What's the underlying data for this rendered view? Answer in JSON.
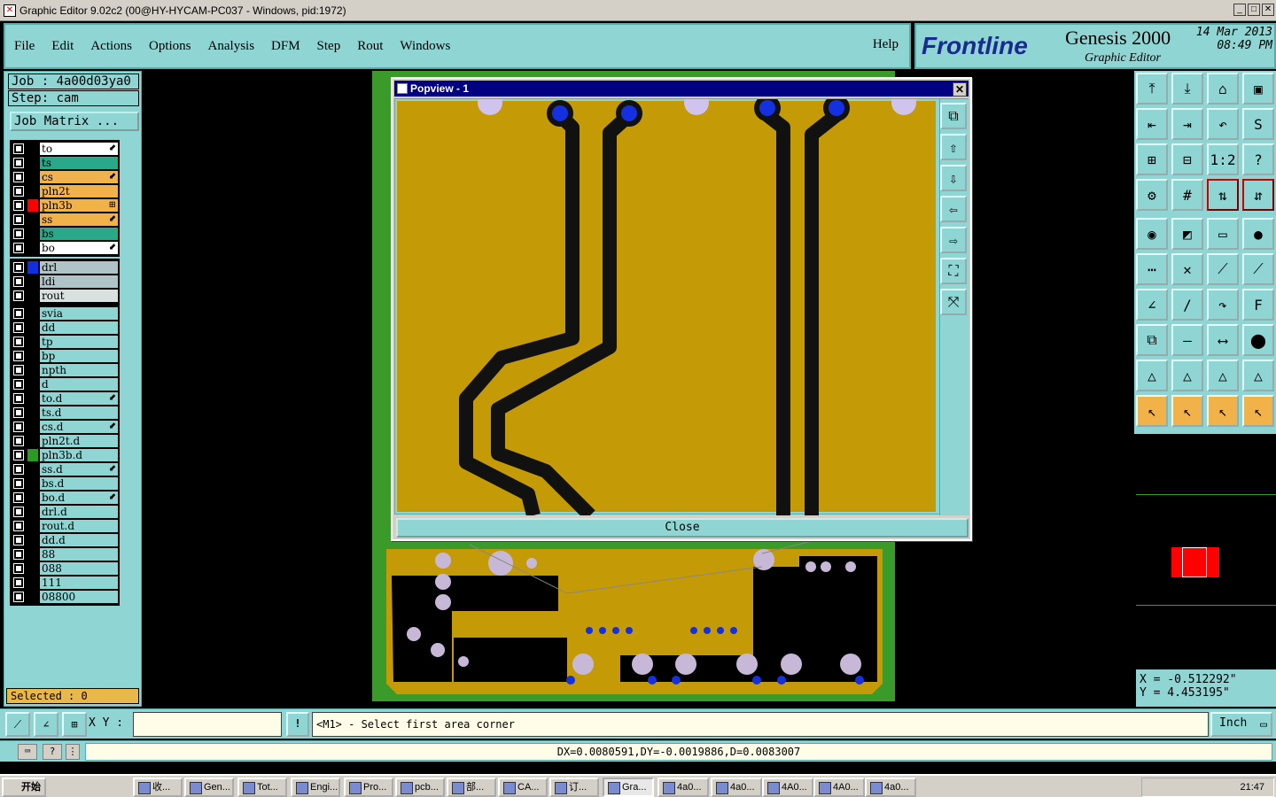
{
  "window": {
    "title": "Graphic Editor 9.02c2 (00@HY-HYCAM-PC037 - Windows, pid:1972)"
  },
  "menu": {
    "items": [
      "File",
      "Edit",
      "Actions",
      "Options",
      "Analysis",
      "DFM",
      "Step",
      "Rout",
      "Windows"
    ],
    "help": "Help"
  },
  "brand": {
    "logo": "Frontline",
    "product": "Genesis 2000",
    "subtitle": "Graphic Editor",
    "date": "14 Mar 2013",
    "time": "08:49 PM"
  },
  "job": {
    "job": "Job : 4a00d03ya0",
    "step": "Step: cam",
    "matrix_button": "Job Matrix ..."
  },
  "layers_group1": [
    {
      "name": "to",
      "color": "#ffffff",
      "mark": "⬋",
      "sw": "#000000"
    },
    {
      "name": "ts",
      "color": "#2aa88a",
      "mark": "",
      "sw": "#000000"
    },
    {
      "name": "cs",
      "color": "#f2b24a",
      "mark": "⬋",
      "sw": "#000000"
    },
    {
      "name": "pln2t",
      "color": "#f2b24a",
      "mark": "",
      "sw": "#000000"
    },
    {
      "name": "pln3b",
      "color": "#f2b24a",
      "mark": "⊞",
      "sw": "#ff0000"
    },
    {
      "name": "ss",
      "color": "#f2b24a",
      "mark": "⬋",
      "sw": "#000000"
    },
    {
      "name": "bs",
      "color": "#2aa88a",
      "mark": "",
      "sw": "#000000"
    },
    {
      "name": "bo",
      "color": "#ffffff",
      "mark": "⬋",
      "sw": "#000000"
    }
  ],
  "layers_group2": [
    {
      "name": "drl",
      "color": "#b0c4c8",
      "mark": "",
      "sw": "#1030e0"
    },
    {
      "name": "ldi",
      "color": "#b0c4c8",
      "mark": "",
      "sw": "#000000"
    },
    {
      "name": "rout",
      "color": "#d8e0e0",
      "mark": "",
      "sw": "#000000"
    }
  ],
  "layers_group3": [
    {
      "name": "svia",
      "mark": "",
      "sw": "#000000"
    },
    {
      "name": "dd",
      "mark": "",
      "sw": "#000000"
    },
    {
      "name": "tp",
      "mark": "",
      "sw": "#000000"
    },
    {
      "name": "bp",
      "mark": "",
      "sw": "#000000"
    },
    {
      "name": "npth",
      "mark": "",
      "sw": "#000000"
    },
    {
      "name": "d",
      "mark": "",
      "sw": "#000000"
    },
    {
      "name": "to.d",
      "mark": "⬋",
      "sw": "#000000"
    },
    {
      "name": "ts.d",
      "mark": "",
      "sw": "#000000"
    },
    {
      "name": "cs.d",
      "mark": "⬋",
      "sw": "#000000"
    },
    {
      "name": "pln2t.d",
      "mark": "",
      "sw": "#000000"
    },
    {
      "name": "pln3b.d",
      "mark": "",
      "sw": "#2a9a20"
    },
    {
      "name": "ss.d",
      "mark": "⬋",
      "sw": "#000000"
    },
    {
      "name": "bs.d",
      "mark": "",
      "sw": "#000000"
    },
    {
      "name": "bo.d",
      "mark": "⬋",
      "sw": "#000000"
    },
    {
      "name": "drl.d",
      "mark": "",
      "sw": "#000000"
    },
    {
      "name": "rout.d",
      "mark": "",
      "sw": "#000000"
    },
    {
      "name": "dd.d",
      "mark": "",
      "sw": "#000000"
    },
    {
      "name": "88",
      "mark": "",
      "sw": "#000000"
    },
    {
      "name": "088",
      "mark": "",
      "sw": "#000000"
    },
    {
      "name": "111",
      "mark": "",
      "sw": "#000000"
    },
    {
      "name": "08800",
      "mark": "",
      "sw": "#000000"
    }
  ],
  "selected": "Selected : 0",
  "popview": {
    "title": "Popview - 1",
    "close_button": "Close"
  },
  "coords": {
    "x": "X = -0.512292\"",
    "y": "Y = 4.453195\""
  },
  "command": {
    "xy_label": "X Y :",
    "xy_value": "",
    "warn": "!",
    "prompt": "<M1> - Select first area corner",
    "units": "Inch"
  },
  "measure": "DX=0.0080591,DY=-0.0019886,D=0.0083007",
  "taskbar": {
    "start": "开始",
    "items": [
      "收...",
      "Gen...",
      "Tot...",
      "Engi...",
      "Pro...",
      "pcb...",
      "部...",
      "CA...",
      "订...",
      "Gra...",
      "4a0...",
      "4a0...",
      "4A0...",
      "4A0...",
      "4a0..."
    ],
    "clock": "21:47"
  },
  "colors": {
    "panel": "#8fd5d3",
    "copper": "#c49a06",
    "trace": "#111111",
    "pad_blue": "#1530e0",
    "board_green": "#3a9a2a"
  }
}
